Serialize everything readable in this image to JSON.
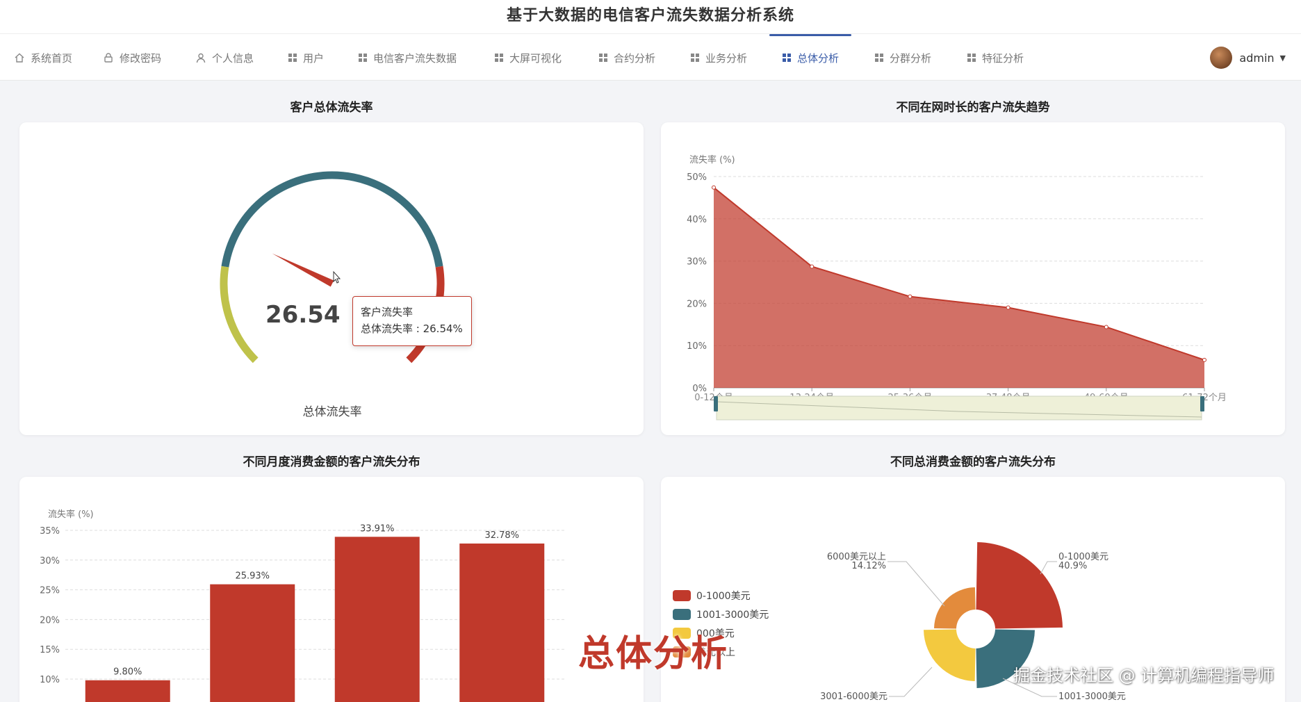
{
  "app_title": "基于大数据的电信客户流失数据分析系统",
  "nav": [
    {
      "label": "系统首页",
      "icon": "home-icon"
    },
    {
      "label": "修改密码",
      "icon": "lock-icon"
    },
    {
      "label": "个人信息",
      "icon": "user-icon"
    },
    {
      "label": "用户",
      "icon": "grid-icon"
    },
    {
      "label": "电信客户流失数据",
      "icon": "grid-icon"
    },
    {
      "label": "大屏可视化",
      "icon": "grid-icon"
    },
    {
      "label": "合约分析",
      "icon": "grid-icon"
    },
    {
      "label": "业务分析",
      "icon": "grid-icon"
    },
    {
      "label": "总体分析",
      "icon": "grid-icon",
      "active": true
    },
    {
      "label": "分群分析",
      "icon": "grid-icon"
    },
    {
      "label": "特征分析",
      "icon": "grid-icon"
    }
  ],
  "user": {
    "name": "admin"
  },
  "overlay_title": "总体分析",
  "watermark": "掘金技术社区 @ 计算机编程指导师",
  "colors": {
    "red": "#c0392b",
    "teal": "#3a6f7c",
    "olive": "#bfc24a",
    "orange": "#e38b3c",
    "yellow": "#f3c93f",
    "active": "#3a5ca8"
  },
  "chart_data": [
    {
      "type": "gauge",
      "title": "客户总体流失率",
      "value": 26.54,
      "min": 0,
      "max": 100,
      "value_text": "26.54",
      "detail_label": "总体流失率",
      "tooltip": {
        "title": "客户流失率",
        "line": "总体流失率 : 26.54%"
      }
    },
    {
      "type": "area",
      "title": "不同在网时长的客户流失趋势",
      "ylabel": "流失率 (%)",
      "categories": [
        "0-12个月",
        "13-24个月",
        "25-36个月",
        "37-48个月",
        "49-60个月",
        "61-72个月"
      ],
      "values": [
        47.4,
        28.7,
        21.6,
        19.0,
        14.4,
        6.6
      ],
      "yticks": [
        "0%",
        "10%",
        "20%",
        "30%",
        "40%",
        "50%"
      ],
      "ylim": [
        0,
        50
      ],
      "grid": true,
      "data_zoom": true
    },
    {
      "type": "bar",
      "title": "不同月度消费金额的客户流失分布",
      "ylabel": "流失率 (%)",
      "values": [
        9.8,
        25.93,
        33.91,
        32.78
      ],
      "labels": [
        "9.80%",
        "25.93%",
        "33.91%",
        "32.78%"
      ],
      "yticks": [
        "10%",
        "15%",
        "20%",
        "25%",
        "30%",
        "35%"
      ],
      "ylim": [
        0,
        35
      ],
      "grid": true
    },
    {
      "type": "pie",
      "title": "不同总消费金额的客户流失分布",
      "rose": true,
      "slices": [
        {
          "name": "0-1000美元",
          "value": 40.9,
          "pct": "40.9%"
        },
        {
          "name": "1001-3000美元",
          "value": 26.5,
          "pct": ""
        },
        {
          "name": "3001-6000美元",
          "value": 18.5,
          "pct": ""
        },
        {
          "name": "6000美元以上",
          "value": 14.12,
          "pct": "14.12%"
        }
      ],
      "legend_visible": [
        "0-1000美元",
        "1001-3000美元",
        "000美元",
        "美元以上"
      ],
      "legend_position": "left"
    }
  ]
}
